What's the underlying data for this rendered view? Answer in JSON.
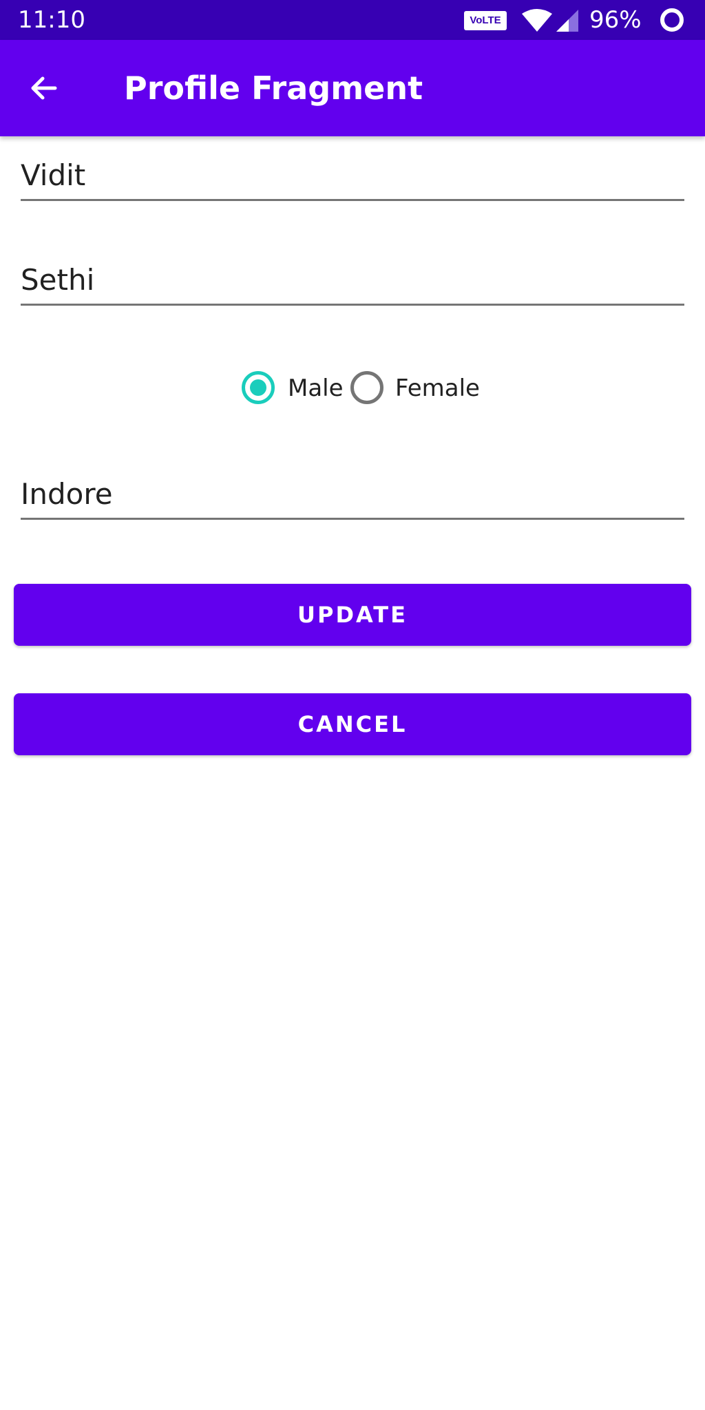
{
  "status_bar": {
    "time": "11:10",
    "volte": "VoLTE",
    "battery": "96%",
    "icons": [
      "volte-icon",
      "wifi-icon",
      "signal-icon",
      "battery-icon"
    ]
  },
  "app_bar": {
    "title": "Profile Fragment",
    "back_icon": "arrow-left-icon"
  },
  "form": {
    "first_name": "Vidit",
    "last_name": "Sethi",
    "gender": {
      "options": [
        "Male",
        "Female"
      ],
      "selected": "Male"
    },
    "city": "Indore"
  },
  "buttons": {
    "update": "UPDATE",
    "cancel": "CANCEL"
  },
  "colors": {
    "status_bar": "#3700B3",
    "primary": "#6200EE",
    "radio_accent": "#1ACDBC",
    "radio_unselected": "#757575"
  }
}
